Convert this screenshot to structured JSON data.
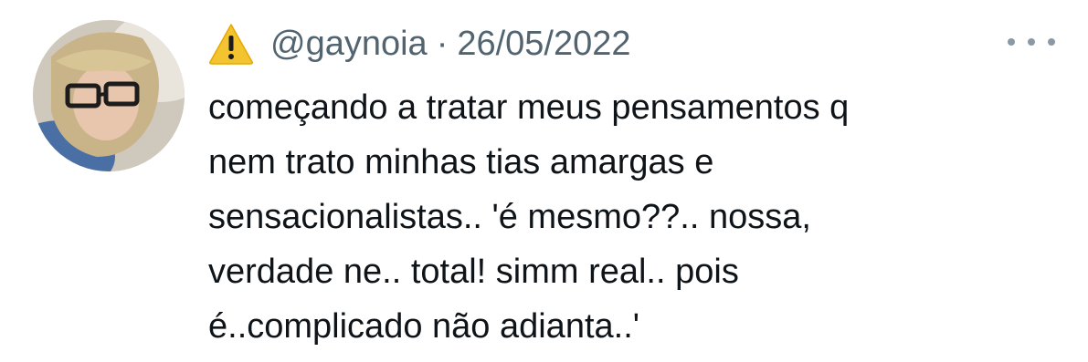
{
  "tweet": {
    "handle": "@gaynoia",
    "separator": "·",
    "date": "26/05/2022",
    "status_emoji_icon": "warning-icon",
    "more_icon": "more-horizontal-icon",
    "text": "começando a tratar meus pensamentos  q\nnem trato minhas tias amargas e\nsensacionalistas.. 'é mesmo??.. nossa,\nverdade ne.. total! simm real.. pois\né..complicado  não adianta..'"
  },
  "colors": {
    "text": "#0f1419",
    "secondary": "#536471",
    "warning": "#F4C430",
    "background": "#ffffff"
  }
}
